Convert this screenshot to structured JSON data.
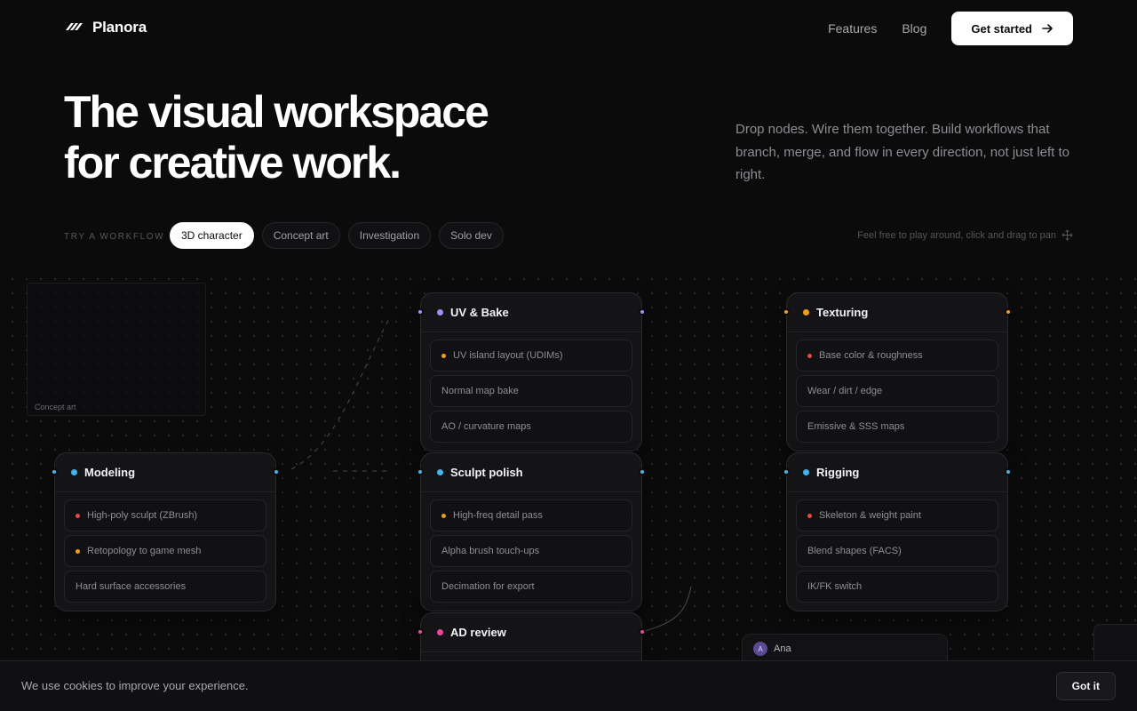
{
  "brand": {
    "name": "Planora",
    "logo_icon": "stripes-logo-icon"
  },
  "nav": {
    "features": "Features",
    "blog": "Blog",
    "cta": "Get started",
    "cta_icon": "arrow-right-icon"
  },
  "hero": {
    "title_line1": "The visual workspace",
    "title_line2": "for creative work.",
    "description": "Drop nodes. Wire them together. Build workflows that branch, merge, and flow in every direction, not just left to right."
  },
  "workflow": {
    "label": "TRY A WORKFLOW",
    "options": [
      "3D character",
      "Concept art",
      "Investigation",
      "Solo dev"
    ],
    "selected": "3D character",
    "hint": "Feel free to play around, click and drag to pan",
    "hint_icon": "move-icon"
  },
  "canvas": {
    "ghost_label": "Concept art",
    "nodes": {
      "modeling": {
        "title": "Modeling",
        "color": "#3fb6ec",
        "items": [
          {
            "label": "High-poly sculpt (ZBrush)",
            "dot": "#ef4444"
          },
          {
            "label": "Retopology to game mesh",
            "dot": "#f59e0b"
          },
          {
            "label": "Hard surface accessories",
            "dot": ""
          }
        ]
      },
      "uv": {
        "title": "UV & Bake",
        "color": "#a78bfa",
        "items": [
          {
            "label": "UV island layout (UDIMs)",
            "dot": "#f59e0b"
          },
          {
            "label": "Normal map bake",
            "dot": ""
          },
          {
            "label": "AO / curvature maps",
            "dot": ""
          }
        ]
      },
      "sculpt": {
        "title": "Sculpt polish",
        "color": "#3fb6ec",
        "items": [
          {
            "label": "High-freq detail pass",
            "dot": "#f59e0b"
          },
          {
            "label": "Alpha brush touch-ups",
            "dot": ""
          },
          {
            "label": "Decimation for export",
            "dot": ""
          }
        ]
      },
      "ad": {
        "title": "AD review",
        "color": "#ec4899"
      },
      "texturing": {
        "title": "Texturing",
        "color": "#f59e0b",
        "items": [
          {
            "label": "Base color & roughness",
            "dot": "#ef4444"
          },
          {
            "label": "Wear / dirt / edge",
            "dot": ""
          },
          {
            "label": "Emissive & SSS maps",
            "dot": ""
          }
        ]
      },
      "rigging": {
        "title": "Rigging",
        "color": "#3fb6ec",
        "items": [
          {
            "label": "Skeleton & weight paint",
            "dot": "#ef4444"
          },
          {
            "label": "Blend shapes (FACS)",
            "dot": ""
          },
          {
            "label": "IK/FK switch",
            "dot": ""
          }
        ]
      }
    },
    "presence": {
      "initial": "A",
      "name": "Ana"
    }
  },
  "cookie": {
    "text": "We use cookies to improve your experience.",
    "button": "Got it"
  }
}
